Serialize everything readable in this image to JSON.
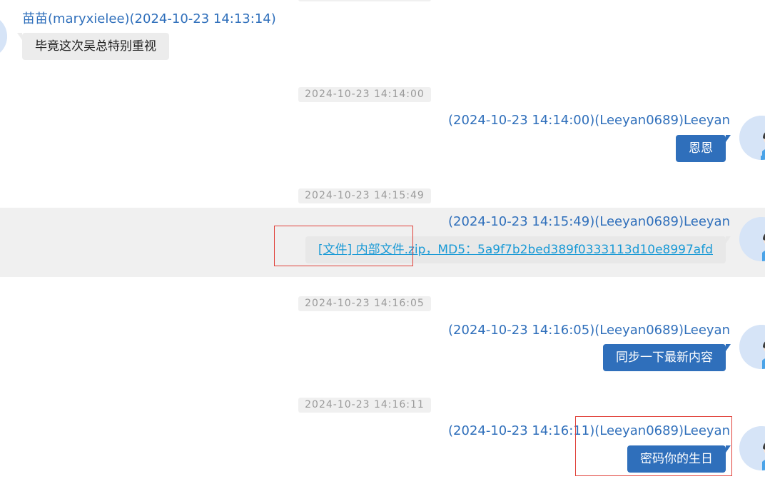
{
  "messages": {
    "m1": {
      "header": "苗苗(maryxielee)(2024-10-23 14:13:14)",
      "text": "毕竟这次吴总特别重视"
    },
    "d2": "2024-10-23 14:14:00",
    "m2": {
      "header": "(2024-10-23 14:14:00)(Leeyan0689)Leeyan",
      "text": "恩恩"
    },
    "d3": "2024-10-23 14:15:49",
    "m3": {
      "header": "(2024-10-23 14:15:49)(Leeyan0689)Leeyan",
      "text": "[文件] 内部文件.zip，MD5：5a9f7b2bed389f0333113d10e8997afd"
    },
    "d4": "2024-10-23 14:16:05",
    "m4": {
      "header": "(2024-10-23 14:16:05)(Leeyan0689)Leeyan",
      "text": "同步一下最新内容"
    },
    "d5": "2024-10-23 14:16:11",
    "m5": {
      "header": "(2024-10-23 14:16:11)(Leeyan0689)Leeyan",
      "text": "密码你的生日"
    }
  },
  "colors": {
    "header_blue": "#2f6fbb",
    "outgoing_bubble": "#2f6fbb",
    "incoming_bubble": "#ececec",
    "file_link": "#1a9ad6",
    "annotation_red": "#e0413a"
  },
  "icons": {
    "contact_avatar": "avatar-icon",
    "user_avatar": "cartoon-user-avatar-icon"
  }
}
